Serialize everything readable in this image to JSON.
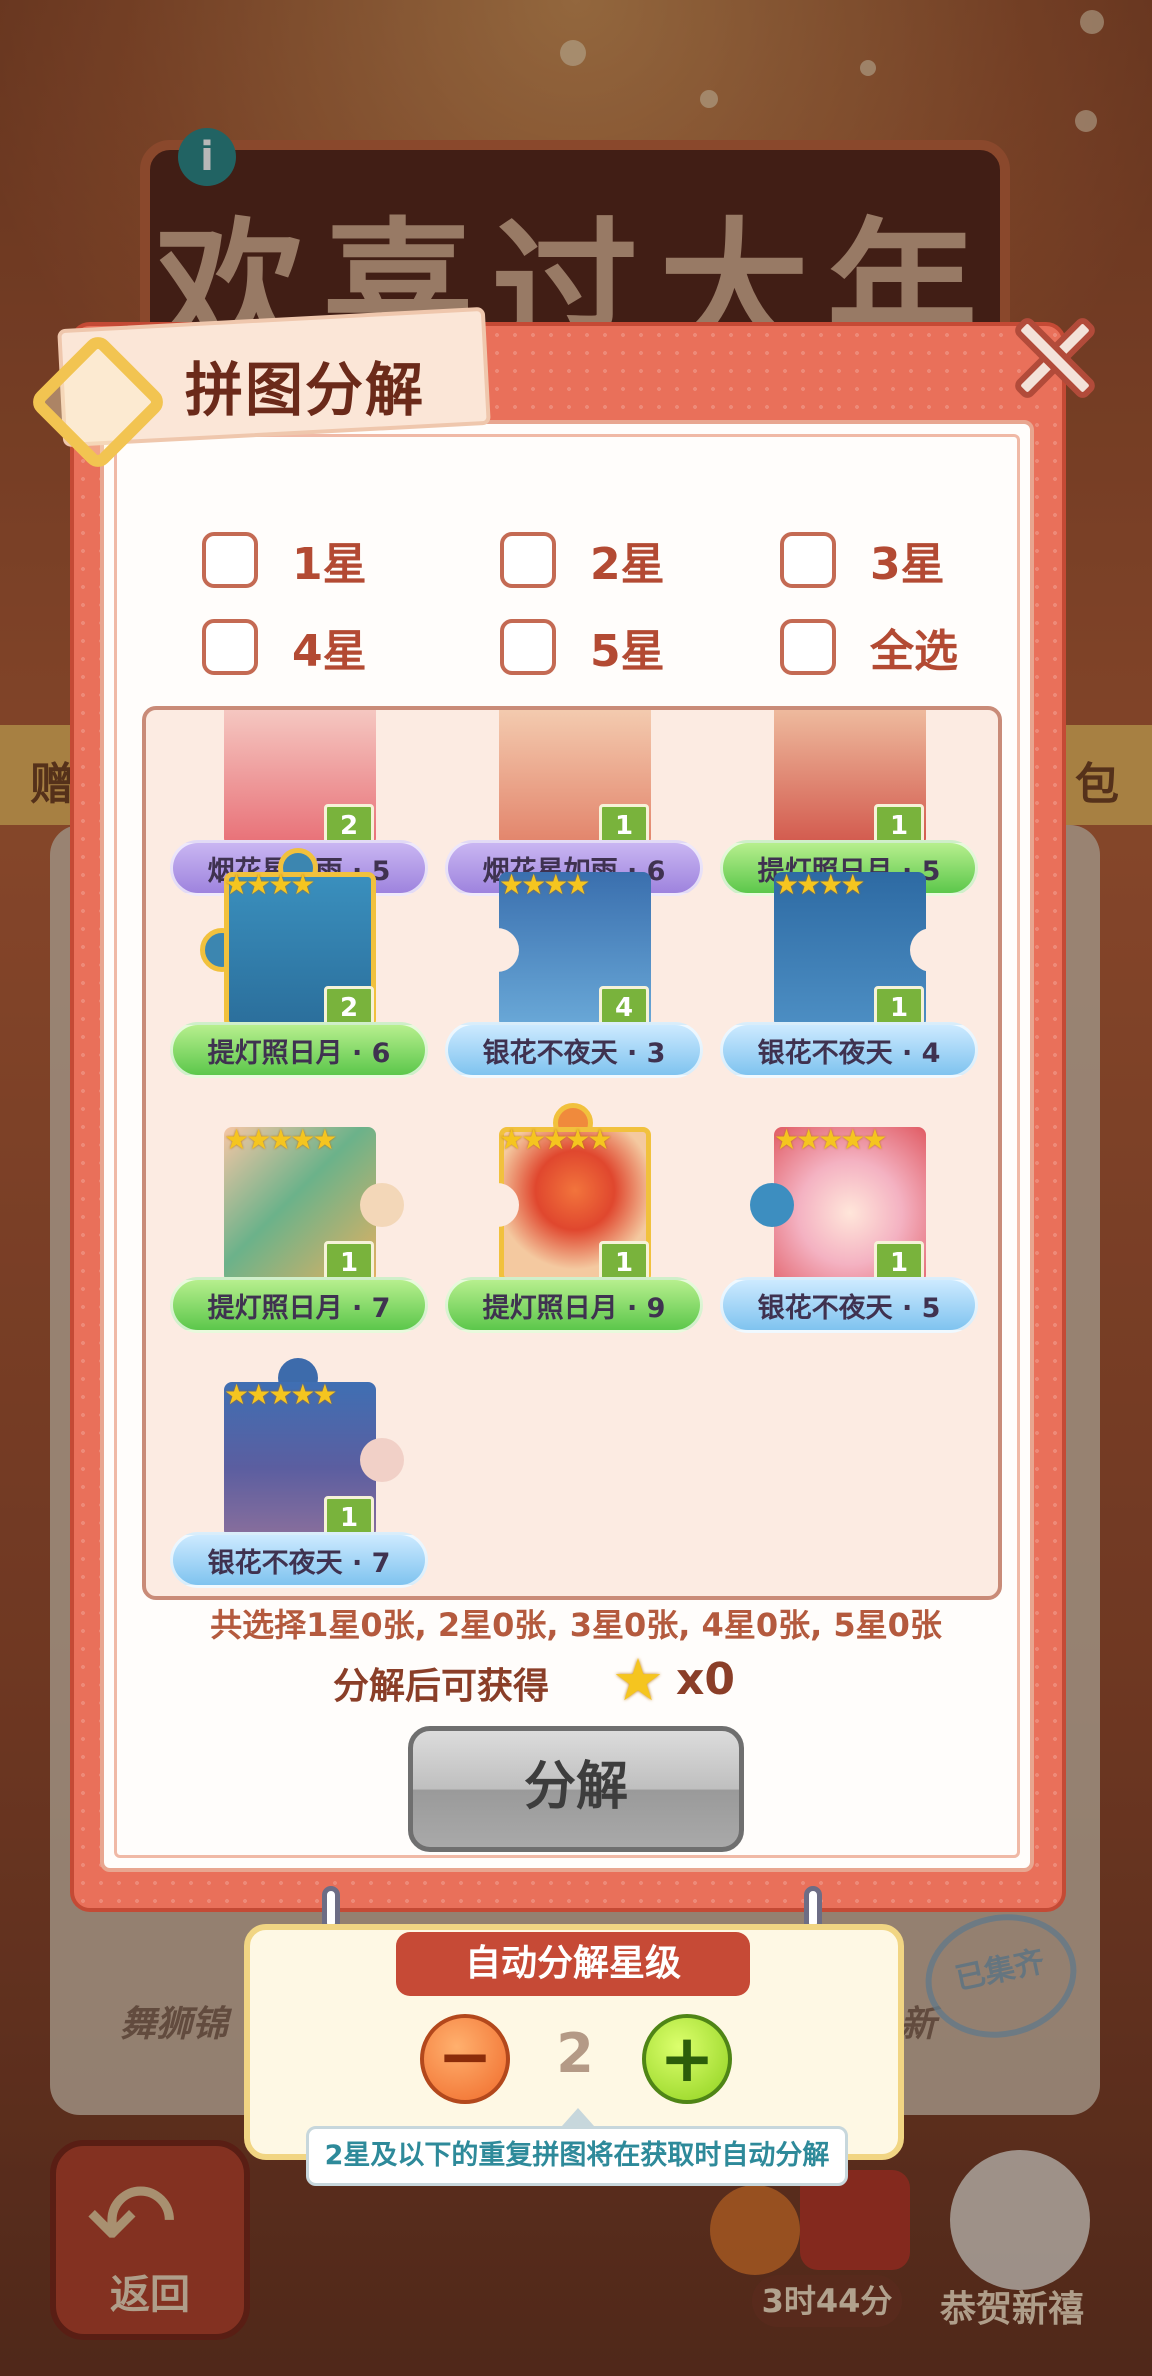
{
  "background": {
    "banner_title": "欢喜过大年",
    "left_side_text": "赠",
    "right_side_text": "包",
    "card_text_left": "舞狮锦",
    "card_text_right": "新",
    "stamp_text": "已集齐",
    "back_label": "返回",
    "timer": "3时44分",
    "newyear_label": "恭贺新禧"
  },
  "modal": {
    "title": "拼图分解",
    "filters": [
      {
        "label": "1星"
      },
      {
        "label": "2星"
      },
      {
        "label": "3星"
      },
      {
        "label": "4星"
      },
      {
        "label": "5星"
      },
      {
        "label": "全选"
      }
    ],
    "puzzles": [
      {
        "name": "烟花星如雨 · 5",
        "count": "2",
        "stars": "",
        "ribbon": "purple"
      },
      {
        "name": "烟花星如雨 · 6",
        "count": "1",
        "stars": "",
        "ribbon": "purple"
      },
      {
        "name": "提灯照日月 · 5",
        "count": "1",
        "stars": "",
        "ribbon": "green"
      },
      {
        "name": "提灯照日月 · 6",
        "count": "2",
        "stars": "★★★★",
        "ribbon": "green"
      },
      {
        "name": "银花不夜天 · 3",
        "count": "4",
        "stars": "★★★★",
        "ribbon": "blue"
      },
      {
        "name": "银花不夜天 · 4",
        "count": "1",
        "stars": "★★★★",
        "ribbon": "blue"
      },
      {
        "name": "提灯照日月 · 7",
        "count": "1",
        "stars": "★★★★★",
        "ribbon": "green"
      },
      {
        "name": "提灯照日月 · 9",
        "count": "1",
        "stars": "★★★★★",
        "ribbon": "green"
      },
      {
        "name": "银花不夜天 · 5",
        "count": "1",
        "stars": "★★★★★",
        "ribbon": "blue"
      },
      {
        "name": "银花不夜天 · 7",
        "count": "1",
        "stars": "★★★★★",
        "ribbon": "blue"
      }
    ],
    "summary": "共选择1星0张, 2星0张, 3星0张, 4星0张, 5星0张",
    "reward_label": "分解后可获得",
    "reward_count": "x0",
    "decompose_button": "分解"
  },
  "auto": {
    "title": "自动分解星级",
    "minus": "−",
    "plus": "+",
    "level": "2",
    "tip": "2星及以下的重复拼图将在获取时自动分解"
  },
  "colors": {
    "modal_frame": "#e9705a",
    "accent_red": "#c64a36",
    "ribbon_purple": "#9e83de",
    "ribbon_green": "#5cc74b",
    "ribbon_blue": "#7fc3ef",
    "count_badge": "#79b33c",
    "star": "#f5c51f"
  },
  "icons": {
    "info": "info-icon",
    "close": "close-icon",
    "star": "star-icon",
    "minus": "minus-icon",
    "plus": "plus-icon",
    "back": "back-arrow-icon"
  }
}
